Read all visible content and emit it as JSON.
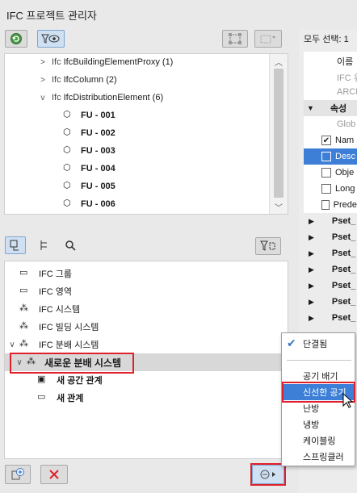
{
  "window": {
    "title": "IFC 프로젝트 관리자"
  },
  "top_tree": {
    "items": [
      {
        "label": "IfcBuildingElementProxy (1)",
        "chevron": ">"
      },
      {
        "label": "IfcColumn (2)",
        "chevron": ">"
      },
      {
        "label": "IfcDistributionElement (6)",
        "chevron": "v"
      }
    ],
    "children": [
      "FU - 001",
      "FU - 002",
      "FU - 003",
      "FU - 004",
      "FU - 005",
      "FU - 006"
    ]
  },
  "bottom_tree": {
    "items": [
      {
        "label": "IFC 그룹"
      },
      {
        "label": "IFC 영역"
      },
      {
        "label": "IFC 시스템"
      },
      {
        "label": "IFC 빌딩 시스템"
      },
      {
        "label": "IFC 분배 시스템"
      }
    ],
    "selected": "새로운 분배 시스템",
    "children": [
      "새 공간 관계",
      "새 관계"
    ]
  },
  "right_panel": {
    "select_all": "모두 선택: 1",
    "name_header": "이름",
    "lines": [
      "IFC 유",
      "ARCH"
    ],
    "section": "속성",
    "global": "Glob",
    "props": [
      {
        "label": "Nam",
        "checked": true,
        "highlight": false
      },
      {
        "label": "Desc",
        "checked": false,
        "highlight": true
      },
      {
        "label": "Obje",
        "checked": false,
        "highlight": false
      },
      {
        "label": "Long",
        "checked": false,
        "highlight": false
      },
      {
        "label": "Prede",
        "checked": false,
        "highlight": false
      }
    ],
    "psets": [
      "Pset_",
      "Pset_",
      "Pset_",
      "Pset_",
      "Pset_",
      "Pset_",
      "Pset_"
    ]
  },
  "context_menu": {
    "checked_item": "단결됨",
    "items": [
      "공기 배기",
      "신선한 공기",
      "난방",
      "냉방",
      "케이블링",
      "스프링클러"
    ],
    "highlighted": "신선한 공기"
  },
  "colors": {
    "selection_blue": "#3d7fd6",
    "highlight_red": "#e0202a",
    "accent_green": "#3a8a3a"
  }
}
